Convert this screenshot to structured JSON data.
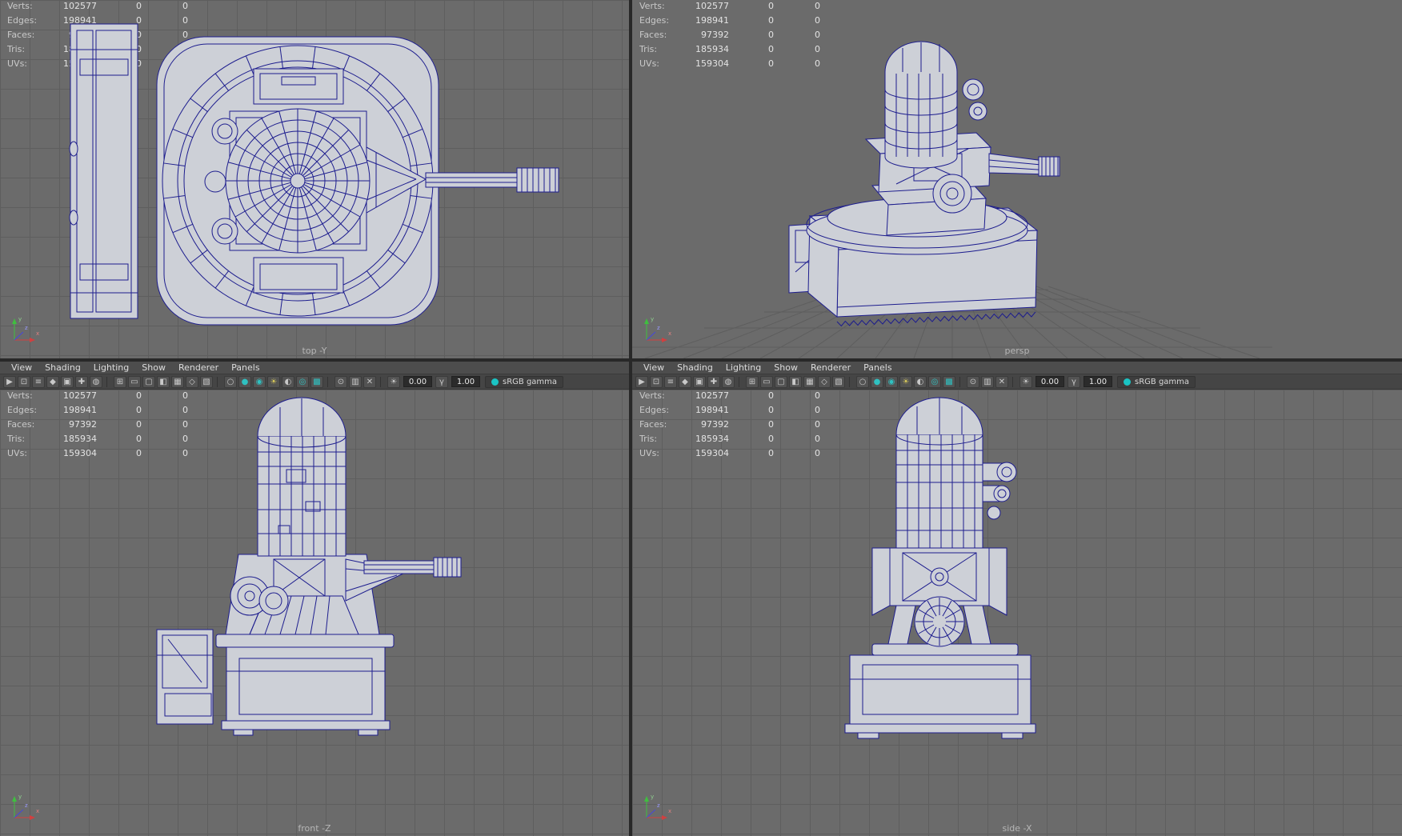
{
  "viewports": [
    {
      "label": "top -Y"
    },
    {
      "label": "persp"
    },
    {
      "label": "front -Z"
    },
    {
      "label": "side -X"
    }
  ],
  "stats_rows": [
    {
      "label": "Verts:",
      "v1": "102577",
      "v2": "0",
      "v3": "0"
    },
    {
      "label": "Edges:",
      "v1": "198941",
      "v2": "0",
      "v3": "0"
    },
    {
      "label": "Faces:",
      "v1": "97392",
      "v2": "0",
      "v3": "0"
    },
    {
      "label": "Tris:",
      "v1": "185934",
      "v2": "0",
      "v3": "0"
    },
    {
      "label": "UVs:",
      "v1": "159304",
      "v2": "0",
      "v3": "0"
    }
  ],
  "menus": [
    "View",
    "Shading",
    "Lighting",
    "Show",
    "Renderer",
    "Panels"
  ],
  "toolbar": {
    "exposure_value": "0.00",
    "gamma_value": "1.00",
    "colorspace_label": "sRGB gamma",
    "icons": [
      {
        "name": "camera-select-icon",
        "glyph": "▶"
      },
      {
        "name": "camera-lock-icon",
        "glyph": "⊡"
      },
      {
        "name": "camera-attributes-icon",
        "glyph": "≡"
      },
      {
        "name": "bookmarks-icon",
        "glyph": "◆"
      },
      {
        "name": "image-plane-icon",
        "glyph": "▣"
      },
      {
        "name": "pan-zoom-icon",
        "glyph": "✚"
      },
      {
        "name": "oversampling-icon",
        "glyph": "◍"
      },
      {
        "sep": true
      },
      {
        "name": "grid-icon",
        "glyph": "⊞"
      },
      {
        "name": "film-gate-icon",
        "glyph": "▭"
      },
      {
        "name": "resolution-gate-icon",
        "glyph": "▢"
      },
      {
        "name": "gate-mask-icon",
        "glyph": "◧"
      },
      {
        "name": "field-chart-icon",
        "glyph": "▦"
      },
      {
        "name": "safe-action-icon",
        "glyph": "◇"
      },
      {
        "name": "safe-title-icon",
        "glyph": "▧"
      },
      {
        "sep": true
      },
      {
        "name": "wireframe-icon",
        "glyph": "○"
      },
      {
        "name": "smooth-shade-icon",
        "glyph": "●",
        "color": "#2fc1c1"
      },
      {
        "name": "textured-icon",
        "glyph": "◉",
        "color": "#2fc1c1"
      },
      {
        "name": "use-all-lights-icon",
        "glyph": "☀",
        "color": "#d8c95a"
      },
      {
        "name": "shadows-icon",
        "glyph": "◐"
      },
      {
        "name": "occlusion-icon",
        "glyph": "◎",
        "color": "#2fc1c1"
      },
      {
        "name": "anti-aliasing-icon",
        "glyph": "▩",
        "color": "#2fc1c1"
      },
      {
        "sep": true
      },
      {
        "name": "isolate-select-icon",
        "glyph": "⊙"
      },
      {
        "name": "x-ray-icon",
        "glyph": "▥"
      },
      {
        "name": "joints-x-ray-icon",
        "glyph": "✕"
      },
      {
        "sep": true
      }
    ]
  },
  "gizmo": {
    "x": "x",
    "y": "y",
    "z": "z"
  },
  "colors": {
    "viewport_bg": "#6b6b6b",
    "grid_line": "#5e5e5e",
    "wireframe": "#1d1d8e",
    "surface_fill": "#cdd0d7",
    "menu_bg": "#4d4d4d",
    "toolbar_bg": "#454545",
    "accent_teal": "#1ac4c4",
    "hud_text": "#c9c9c9",
    "axis_x": "#d04040",
    "axis_y": "#3fbf3f",
    "axis_z": "#4646dd"
  }
}
